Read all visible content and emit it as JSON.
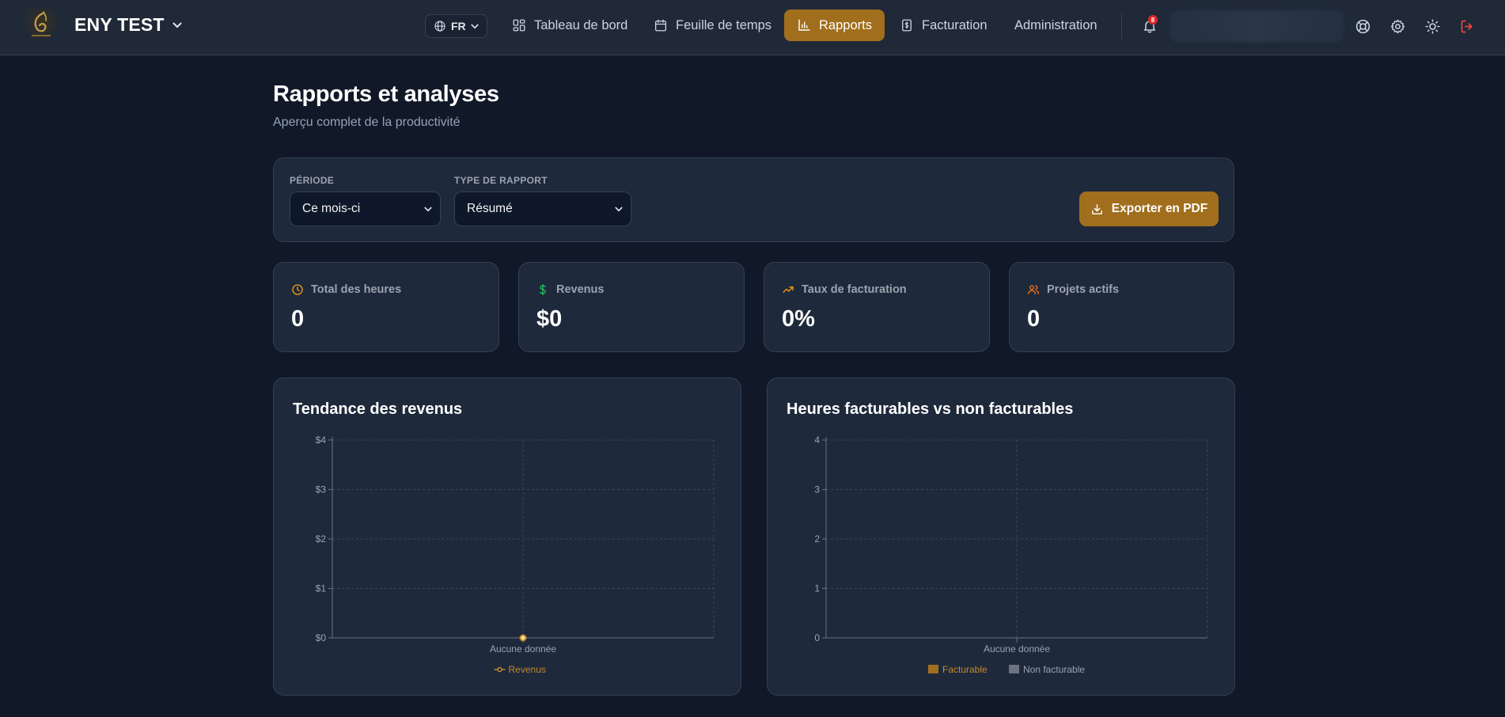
{
  "header": {
    "brand": "ENY TEST",
    "language": "FR",
    "nav": [
      {
        "label": "Tableau de bord",
        "icon": "dashboard-icon"
      },
      {
        "label": "Feuille de temps",
        "icon": "calendar-icon"
      },
      {
        "label": "Rapports",
        "icon": "bar-chart-icon",
        "active": true
      },
      {
        "label": "Facturation",
        "icon": "invoice-icon"
      },
      {
        "label": "Administration",
        "icon": ""
      }
    ],
    "notification_count": "8",
    "accent": "#a06e1c"
  },
  "page": {
    "title": "Rapports et analyses",
    "subtitle": "Aperçu complet de la productivité"
  },
  "filters": {
    "period_label": "PÉRIODE",
    "period_value": "Ce mois-ci",
    "type_label": "TYPE DE RAPPORT",
    "type_value": "Résumé",
    "export_label": "Exporter en PDF"
  },
  "stats": [
    {
      "label": "Total des heures",
      "value": "0",
      "icon": "clock-icon",
      "color": "#f59e0b"
    },
    {
      "label": "Revenus",
      "value": "$0",
      "icon": "dollar-icon",
      "color": "#22c55e"
    },
    {
      "label": "Taux de facturation",
      "value": "0%",
      "icon": "trending-up-icon",
      "color": "#f59e0b"
    },
    {
      "label": "Projets actifs",
      "value": "0",
      "icon": "users-icon",
      "color": "#f97316"
    }
  ],
  "chart_data": [
    {
      "type": "line",
      "title": "Tendance des revenus",
      "categories": [
        "Aucune donnée"
      ],
      "series": [
        {
          "name": "Revenus",
          "values": [
            0
          ],
          "color": "#c28a2c"
        }
      ],
      "yticks": [
        "$0",
        "$1",
        "$2",
        "$3",
        "$4"
      ],
      "ylim": [
        0,
        4
      ],
      "grid": true,
      "legend": "bottom"
    },
    {
      "type": "bar",
      "title": "Heures facturables vs non facturables",
      "categories": [
        "Aucune donnée"
      ],
      "series": [
        {
          "name": "Facturable",
          "values": [
            0
          ],
          "color": "#a06e1c"
        },
        {
          "name": "Non facturable",
          "values": [
            0
          ],
          "color": "#6b7280"
        }
      ],
      "yticks": [
        "0",
        "1",
        "2",
        "3",
        "4"
      ],
      "ylim": [
        0,
        4
      ],
      "grid": true,
      "legend": "bottom"
    }
  ]
}
